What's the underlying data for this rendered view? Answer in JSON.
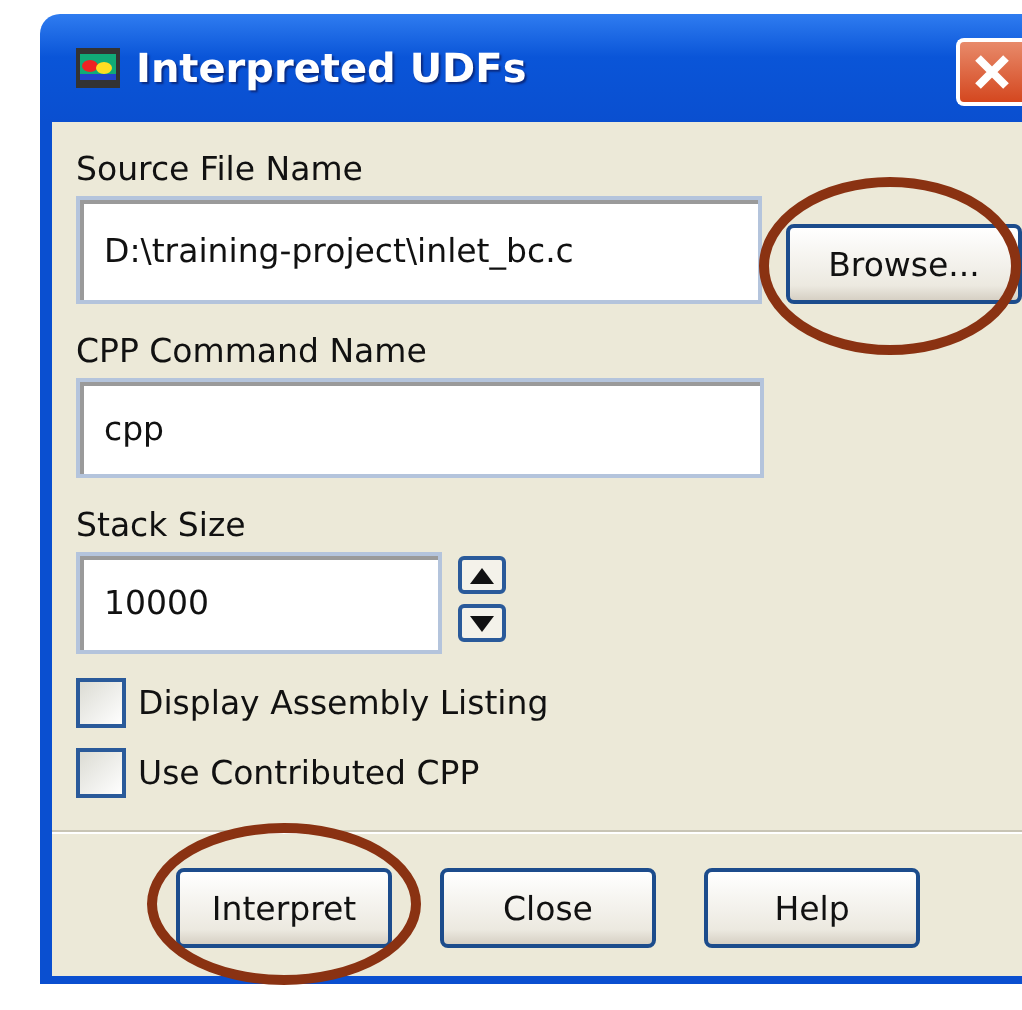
{
  "window": {
    "title": "Interpreted UDFs"
  },
  "source_file": {
    "label": "Source File Name",
    "value": "D:\\training-project\\inlet_bc.c",
    "browse": {
      "label": "Browse...",
      "highlighted": true
    }
  },
  "cpp_command": {
    "label": "CPP Command Name",
    "value": "cpp"
  },
  "stack_size": {
    "label": "Stack Size",
    "value": "10000"
  },
  "checkboxes": [
    {
      "label": "Display Assembly Listing",
      "checked": false
    },
    {
      "label": "Use Contributed CPP",
      "checked": false
    }
  ],
  "buttons": [
    {
      "label": "Interpret",
      "highlighted": true
    },
    {
      "label": "Close",
      "highlighted": false
    },
    {
      "label": "Help",
      "highlighted": false
    }
  ]
}
